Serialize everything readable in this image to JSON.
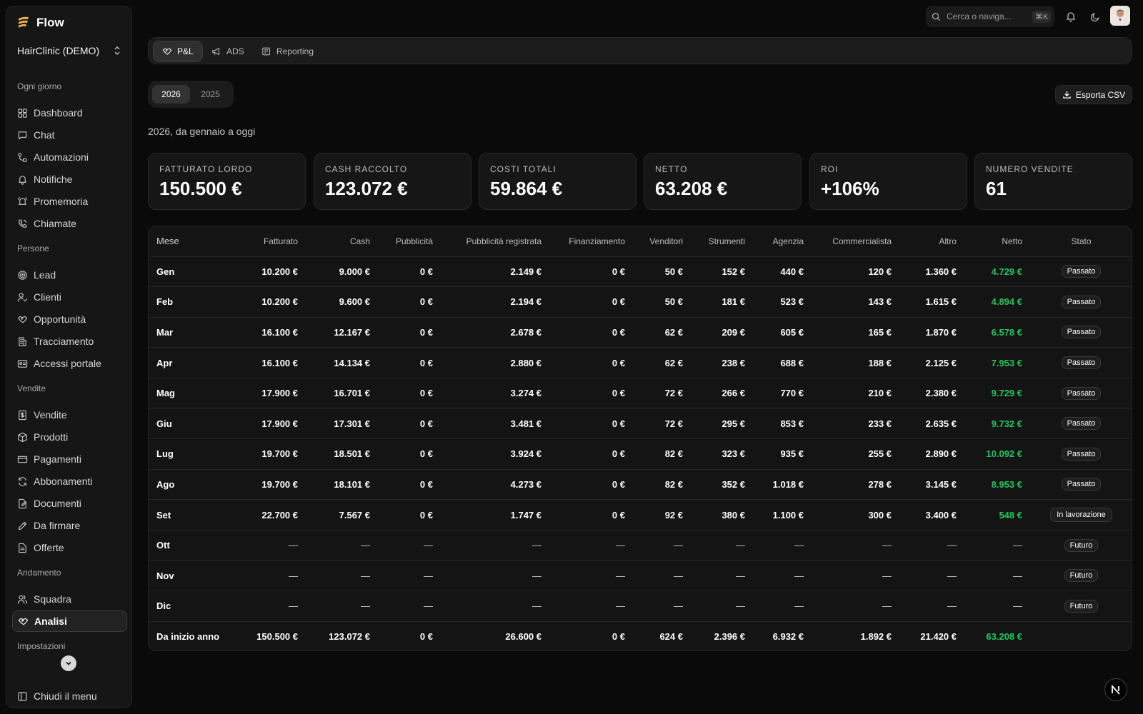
{
  "app": {
    "name": "Flow",
    "org": "HairClinic (DEMO)"
  },
  "sidebar": {
    "sections": [
      {
        "title": "Ogni giorno",
        "items": [
          "Dashboard",
          "Chat",
          "Automazioni",
          "Notifiche",
          "Promemoria",
          "Chiamate"
        ]
      },
      {
        "title": "Persone",
        "items": [
          "Lead",
          "Clienti",
          "Opportunità",
          "Tracciamento",
          "Accessi portale"
        ]
      },
      {
        "title": "Vendite",
        "items": [
          "Vendite",
          "Prodotti",
          "Pagamenti",
          "Abbonamenti",
          "Documenti",
          "Da firmare",
          "Offerte"
        ]
      },
      {
        "title": "Andamento",
        "items": [
          "Squadra",
          "Analisi"
        ]
      },
      {
        "title": "Impostazioni",
        "items": []
      }
    ],
    "active_item": "Analisi",
    "collapse_label": "Chiudi il menu"
  },
  "topbar": {
    "search_placeholder": "Cerca o naviga...",
    "shortcut": "⌘K"
  },
  "tabs": [
    "P&L",
    "ADS",
    "Reporting"
  ],
  "active_tab": "P&L",
  "years": [
    "2026",
    "2025"
  ],
  "active_year": "2026",
  "export_label": "Esporta CSV",
  "subtitle": "2026, da gennaio a oggi",
  "kpis": [
    {
      "label": "Fatturato lordo",
      "value": "150.500 €"
    },
    {
      "label": "Cash raccolto",
      "value": "123.072 €"
    },
    {
      "label": "Costi totali",
      "value": "59.864 €"
    },
    {
      "label": "Netto",
      "value": "63.208 €"
    },
    {
      "label": "ROI",
      "value": "+106%"
    },
    {
      "label": "Numero vendite",
      "value": "61"
    }
  ],
  "table": {
    "columns": [
      "Mese",
      "Fatturato",
      "Cash",
      "Pubblicità",
      "Pubblicità registrata",
      "Finanziamento",
      "Venditori",
      "Strumenti",
      "Agenzia",
      "Commercialista",
      "Altro",
      "Netto",
      "Stato"
    ],
    "rows": [
      [
        "Gen",
        "10.200 €",
        "9.000 €",
        "0 €",
        "2.149 €",
        "0 €",
        "50 €",
        "152 €",
        "440 €",
        "120 €",
        "1.360 €",
        "4.729 €",
        "Passato"
      ],
      [
        "Feb",
        "10.200 €",
        "9.600 €",
        "0 €",
        "2.194 €",
        "0 €",
        "50 €",
        "181 €",
        "523 €",
        "143 €",
        "1.615 €",
        "4.894 €",
        "Passato"
      ],
      [
        "Mar",
        "16.100 €",
        "12.167 €",
        "0 €",
        "2.678 €",
        "0 €",
        "62 €",
        "209 €",
        "605 €",
        "165 €",
        "1.870 €",
        "6.578 €",
        "Passato"
      ],
      [
        "Apr",
        "16.100 €",
        "14.134 €",
        "0 €",
        "2.880 €",
        "0 €",
        "62 €",
        "238 €",
        "688 €",
        "188 €",
        "2.125 €",
        "7.953 €",
        "Passato"
      ],
      [
        "Mag",
        "17.900 €",
        "16.701 €",
        "0 €",
        "3.274 €",
        "0 €",
        "72 €",
        "266 €",
        "770 €",
        "210 €",
        "2.380 €",
        "9.729 €",
        "Passato"
      ],
      [
        "Giu",
        "17.900 €",
        "17.301 €",
        "0 €",
        "3.481 €",
        "0 €",
        "72 €",
        "295 €",
        "853 €",
        "233 €",
        "2.635 €",
        "9.732 €",
        "Passato"
      ],
      [
        "Lug",
        "19.700 €",
        "18.501 €",
        "0 €",
        "3.924 €",
        "0 €",
        "82 €",
        "323 €",
        "935 €",
        "255 €",
        "2.890 €",
        "10.092 €",
        "Passato"
      ],
      [
        "Ago",
        "19.700 €",
        "18.101 €",
        "0 €",
        "4.273 €",
        "0 €",
        "82 €",
        "352 €",
        "1.018 €",
        "278 €",
        "3.145 €",
        "8.953 €",
        "Passato"
      ],
      [
        "Set",
        "22.700 €",
        "7.567 €",
        "0 €",
        "1.747 €",
        "0 €",
        "92 €",
        "380 €",
        "1.100 €",
        "300 €",
        "3.400 €",
        "548 €",
        "In lavorazione"
      ],
      [
        "Ott",
        "—",
        "—",
        "—",
        "—",
        "—",
        "—",
        "—",
        "—",
        "—",
        "—",
        "—",
        "Futuro"
      ],
      [
        "Nov",
        "—",
        "—",
        "—",
        "—",
        "—",
        "—",
        "—",
        "—",
        "—",
        "—",
        "—",
        "Futuro"
      ],
      [
        "Dic",
        "—",
        "—",
        "—",
        "—",
        "—",
        "—",
        "—",
        "—",
        "—",
        "—",
        "—",
        "Futuro"
      ]
    ],
    "total": [
      "Da inizio anno",
      "150.500 €",
      "123.072 €",
      "0 €",
      "26.600 €",
      "0 €",
      "624 €",
      "2.396 €",
      "6.932 €",
      "1.892 €",
      "21.420 €",
      "63.208 €",
      ""
    ]
  },
  "colors": {
    "accent_green": "#22c55e",
    "brand_gold": "#e8b04a",
    "background": "#0a0a0a"
  },
  "icons": {
    "nav": [
      "grid-icon",
      "chat-icon",
      "workflow-icon",
      "bell-icon",
      "bell-ring-icon",
      "phone-icon",
      "target-icon",
      "user-check-icon",
      "handshake-icon",
      "building-icon",
      "id-card-icon",
      "dollar-file-icon",
      "box-icon",
      "credit-card-icon",
      "refresh-icon",
      "file-edit-icon",
      "pen-icon",
      "file-text-icon",
      "users-icon",
      "handshake-icon"
    ]
  }
}
